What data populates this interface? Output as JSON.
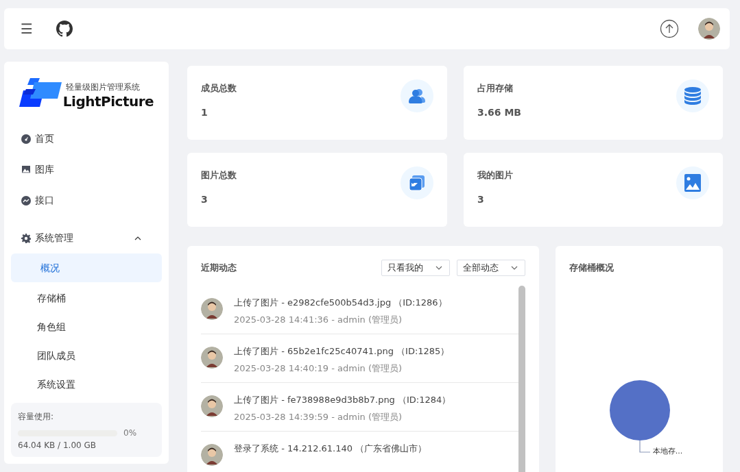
{
  "header": {
    "menu_glyph": "☰"
  },
  "logo": {
    "tagline": "轻量级图片管理系统",
    "name": "LightPicture"
  },
  "sidebar": {
    "items": [
      {
        "label": "首页",
        "selected": false
      },
      {
        "label": "图库",
        "selected": false
      },
      {
        "label": "接口",
        "selected": false
      },
      {
        "label": "系统管理",
        "selected": false,
        "expanded": true,
        "children": [
          {
            "label": "概况",
            "selected": true
          },
          {
            "label": "存储桶",
            "selected": false
          },
          {
            "label": "角色组",
            "selected": false
          },
          {
            "label": "团队成员",
            "selected": false
          },
          {
            "label": "系统设置",
            "selected": false
          }
        ]
      }
    ],
    "usage": {
      "label": "容量使用:",
      "level": 0,
      "percent": "0%",
      "amount": "64.04 KB / 1.00 GB"
    }
  },
  "stats": [
    {
      "label": "成员总数",
      "value": "1"
    },
    {
      "label": "占用存储",
      "value": "3.66 MB"
    },
    {
      "label": "图片总数",
      "value": "3"
    },
    {
      "label": "我的图片",
      "value": "3"
    }
  ],
  "activity": {
    "title": "近期动态",
    "filters": [
      "只看我的",
      "全部动态"
    ],
    "items": [
      {
        "text": "上传了图片 - e2982cfe500b54d3.jpg （ID:1286）",
        "meta": "2025-03-28 14:41:36 - admin (管理员)"
      },
      {
        "text": "上传了图片 - 65b2e1fc25c40741.png （ID:1285）",
        "meta": "2025-03-28 14:40:19 - admin (管理员)"
      },
      {
        "text": "上传了图片 - fe738988e9d3b8b7.png （ID:1284）",
        "meta": "2025-03-28 14:39:59 - admin (管理员)"
      },
      {
        "text": "登录了系统 - 14.212.61.140 （广东省佛山市）"
      }
    ]
  },
  "storage": {
    "title": "存储桶概况",
    "slice_label": "本地存..."
  }
}
